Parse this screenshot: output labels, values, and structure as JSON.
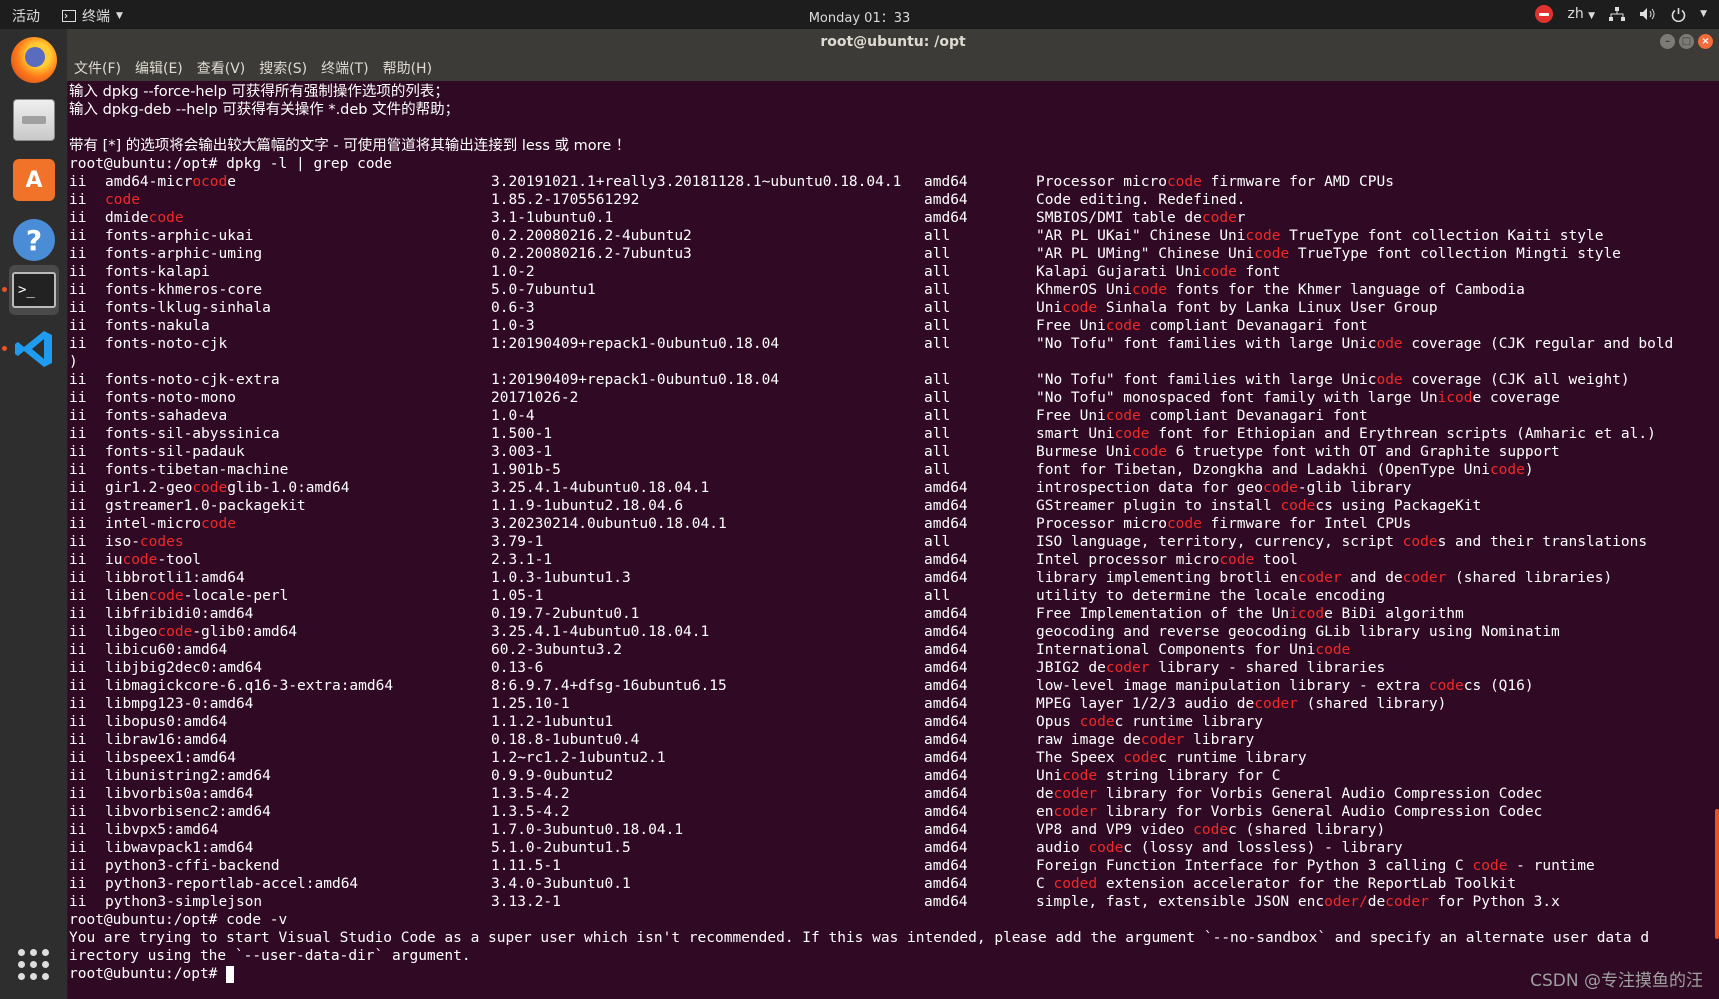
{
  "topbar": {
    "activities": "活动",
    "app_name": "终端",
    "clock": "Monday 01：33",
    "lang": "zh"
  },
  "window": {
    "title": "root@ubuntu: /opt",
    "menus": [
      "文件(F)",
      "编辑(E)",
      "查看(V)",
      "搜索(S)",
      "终端(T)",
      "帮助(H)"
    ]
  },
  "terminal": {
    "intro": [
      "输入 dpkg --force-help 可获得所有强制操作选项的列表；",
      "输入 dpkg-deb --help 可获得有关操作 *.deb 文件的帮助；",
      "",
      "带有 [*] 的选项将会输出较大篇幅的文字 - 可使用管道将其输出连接到 less 或 more ！"
    ],
    "prompt": "root@ubuntu:/opt# ",
    "cmd1": "dpkg -l | grep code",
    "highlight_term": "code",
    "rows": [
      {
        "s": "ii",
        "n": "amd64-microcode",
        "v": "3.20191021.1+really3.20181128.1~ubuntu0.18.04.1",
        "a": "amd64",
        "d": "Processor microcode firmware for AMD CPUs",
        "nh": [
          [
            10,
            14
          ]
        ],
        "dh": [
          [
            15,
            19
          ]
        ]
      },
      {
        "s": "ii",
        "n": "code",
        "v": "1.85.2-1705561292",
        "a": "amd64",
        "d": "Code editing. Redefined.",
        "nh": [
          [
            0,
            4
          ]
        ],
        "dh": []
      },
      {
        "s": "ii",
        "n": "dmidecode",
        "v": "3.1-1ubuntu0.1",
        "a": "amd64",
        "d": "SMBIOS/DMI table decoder",
        "nh": [
          [
            5,
            9
          ]
        ],
        "dh": [
          [
            19,
            23
          ]
        ]
      },
      {
        "s": "ii",
        "n": "fonts-arphic-ukai",
        "v": "0.2.20080216.2-4ubuntu2",
        "a": "all",
        "d": "\"AR PL UKai\" Chinese Unicode TrueType font collection Kaiti style",
        "nh": [],
        "dh": [
          [
            24,
            28
          ]
        ]
      },
      {
        "s": "ii",
        "n": "fonts-arphic-uming",
        "v": "0.2.20080216.2-7ubuntu3",
        "a": "all",
        "d": "\"AR PL UMing\" Chinese Unicode TrueType font collection Mingti style",
        "nh": [],
        "dh": [
          [
            25,
            29
          ]
        ]
      },
      {
        "s": "ii",
        "n": "fonts-kalapi",
        "v": "1.0-2",
        "a": "all",
        "d": "Kalapi Gujarati Unicode font",
        "nh": [],
        "dh": [
          [
            19,
            23
          ]
        ]
      },
      {
        "s": "ii",
        "n": "fonts-khmeros-core",
        "v": "5.0-7ubuntu1",
        "a": "all",
        "d": "KhmerOS Unicode fonts for the Khmer language of Cambodia",
        "nh": [],
        "dh": [
          [
            11,
            15
          ]
        ]
      },
      {
        "s": "ii",
        "n": "fonts-lklug-sinhala",
        "v": "0.6-3",
        "a": "all",
        "d": "Unicode Sinhala font by Lanka Linux User Group",
        "nh": [],
        "dh": [
          [
            3,
            7
          ]
        ]
      },
      {
        "s": "ii",
        "n": "fonts-nakula",
        "v": "1.0-3",
        "a": "all",
        "d": "Free Unicode compliant Devanagari font",
        "nh": [],
        "dh": [
          [
            8,
            12
          ]
        ]
      },
      {
        "s": "ii",
        "n": "fonts-noto-cjk",
        "v": "1:20190409+repack1-0ubuntu0.18.04",
        "a": "all",
        "d": "\"No Tofu\" font families with large Unicode coverage (CJK regular and bold",
        "nh": [],
        "dh": [
          [
            39,
            43
          ]
        ],
        "wrap": ")"
      },
      {
        "s": "ii",
        "n": "fonts-noto-cjk-extra",
        "v": "1:20190409+repack1-0ubuntu0.18.04",
        "a": "all",
        "d": "\"No Tofu\" font families with large Unicode coverage (CJK all weight)",
        "nh": [],
        "dh": [
          [
            39,
            43
          ]
        ]
      },
      {
        "s": "ii",
        "n": "fonts-noto-mono",
        "v": "20171026-2",
        "a": "all",
        "d": "\"No Tofu\" monospaced font family with large Unicode coverage",
        "nh": [],
        "dh": [
          [
            46,
            50
          ]
        ]
      },
      {
        "s": "ii",
        "n": "fonts-sahadeva",
        "v": "1.0-4",
        "a": "all",
        "d": "Free Unicode compliant Devanagari font",
        "nh": [],
        "dh": [
          [
            8,
            12
          ]
        ]
      },
      {
        "s": "ii",
        "n": "fonts-sil-abyssinica",
        "v": "1.500-1",
        "a": "all",
        "d": "smart Unicode font for Ethiopian and Erythrean scripts (Amharic et al.)",
        "nh": [],
        "dh": [
          [
            9,
            13
          ]
        ]
      },
      {
        "s": "ii",
        "n": "fonts-sil-padauk",
        "v": "3.003-1",
        "a": "all",
        "d": "Burmese Unicode 6 truetype font with OT and Graphite support",
        "nh": [],
        "dh": [
          [
            11,
            15
          ]
        ]
      },
      {
        "s": "ii",
        "n": "fonts-tibetan-machine",
        "v": "1.901b-5",
        "a": "all",
        "d": "font for Tibetan, Dzongkha and Ladakhi (OpenType Unicode)",
        "nh": [],
        "dh": [
          [
            52,
            56
          ]
        ]
      },
      {
        "s": "ii",
        "n": "gir1.2-geocodeglib-1.0:amd64",
        "v": "3.25.4.1-4ubuntu0.18.04.1",
        "a": "amd64",
        "d": "introspection data for geocode-glib library",
        "nh": [
          [
            10,
            14
          ]
        ],
        "dh": [
          [
            26,
            30
          ]
        ]
      },
      {
        "s": "ii",
        "n": "gstreamer1.0-packagekit",
        "v": "1.1.9-1ubuntu2.18.04.6",
        "a": "amd64",
        "d": "GStreamer plugin to install codecs using PackageKit",
        "nh": [],
        "dh": [
          [
            28,
            32
          ]
        ]
      },
      {
        "s": "ii",
        "n": "intel-microcode",
        "v": "3.20230214.0ubuntu0.18.04.1",
        "a": "amd64",
        "d": "Processor microcode firmware for Intel CPUs",
        "nh": [
          [
            11,
            15
          ]
        ],
        "dh": [
          [
            15,
            19
          ]
        ]
      },
      {
        "s": "ii",
        "n": "iso-codes",
        "v": "3.79-1",
        "a": "all",
        "d": "ISO language, territory, currency, script codes and their translations",
        "nh": [
          [
            4,
            9
          ]
        ],
        "dh": [
          [
            41,
            46
          ]
        ]
      },
      {
        "s": "ii",
        "n": "iucode-tool",
        "v": "2.3.1-1",
        "a": "amd64",
        "d": "Intel processor microcode tool",
        "nh": [
          [
            2,
            6
          ]
        ],
        "dh": [
          [
            21,
            25
          ]
        ]
      },
      {
        "s": "ii",
        "n": "libbrotli1:amd64",
        "v": "1.0.3-1ubuntu1.3",
        "a": "amd64",
        "d": "library implementing brotli encoder and decoder (shared libraries)",
        "nh": [],
        "dh": [
          [
            30,
            35
          ],
          [
            42,
            47
          ]
        ]
      },
      {
        "s": "ii",
        "n": "libencode-locale-perl",
        "v": "1.05-1",
        "a": "all",
        "d": "utility to determine the locale encoding",
        "nh": [
          [
            5,
            9
          ]
        ],
        "dh": []
      },
      {
        "s": "ii",
        "n": "libfribidi0:amd64",
        "v": "0.19.7-2ubuntu0.1",
        "a": "amd64",
        "d": "Free Implementation of the Unicode BiDi algorithm",
        "nh": [],
        "dh": [
          [
            29,
            33
          ]
        ]
      },
      {
        "s": "ii",
        "n": "libgeocode-glib0:amd64",
        "v": "3.25.4.1-4ubuntu0.18.04.1",
        "a": "amd64",
        "d": "geocoding and reverse geocoding GLib library using Nominatim",
        "nh": [
          [
            6,
            10
          ]
        ],
        "dh": []
      },
      {
        "s": "ii",
        "n": "libicu60:amd64",
        "v": "60.2-3ubuntu3.2",
        "a": "amd64",
        "d": "International Components for Unicode",
        "nh": [],
        "dh": [
          [
            32,
            36
          ]
        ]
      },
      {
        "s": "ii",
        "n": "libjbig2dec0:amd64",
        "v": "0.13-6",
        "a": "amd64",
        "d": "JBIG2 decoder library - shared libraries",
        "nh": [],
        "dh": [
          [
            8,
            13
          ]
        ]
      },
      {
        "s": "ii",
        "n": "libmagickcore-6.q16-3-extra:amd64",
        "v": "8:6.9.7.4+dfsg-16ubuntu6.15",
        "a": "amd64",
        "d": "low-level image manipulation library - extra codecs (Q16)",
        "nh": [],
        "dh": [
          [
            45,
            49
          ]
        ]
      },
      {
        "s": "ii",
        "n": "libmpg123-0:amd64",
        "v": "1.25.10-1",
        "a": "amd64",
        "d": "MPEG layer 1/2/3 audio decoder (shared library)",
        "nh": [],
        "dh": [
          [
            25,
            30
          ]
        ]
      },
      {
        "s": "ii",
        "n": "libopus0:amd64",
        "v": "1.1.2-1ubuntu1",
        "a": "amd64",
        "d": "Opus codec runtime library",
        "nh": [],
        "dh": [
          [
            5,
            9
          ]
        ]
      },
      {
        "s": "ii",
        "n": "libraw16:amd64",
        "v": "0.18.8-1ubuntu0.4",
        "a": "amd64",
        "d": "raw image decoder library",
        "nh": [],
        "dh": [
          [
            12,
            17
          ]
        ]
      },
      {
        "s": "ii",
        "n": "libspeex1:amd64",
        "v": "1.2~rc1.2-1ubuntu2.1",
        "a": "amd64",
        "d": "The Speex codec runtime library",
        "nh": [],
        "dh": [
          [
            10,
            14
          ]
        ]
      },
      {
        "s": "ii",
        "n": "libunistring2:amd64",
        "v": "0.9.9-0ubuntu2",
        "a": "amd64",
        "d": "Unicode string library for C",
        "nh": [],
        "dh": [
          [
            3,
            7
          ]
        ]
      },
      {
        "s": "ii",
        "n": "libvorbis0a:amd64",
        "v": "1.3.5-4.2",
        "a": "amd64",
        "d": "decoder library for Vorbis General Audio Compression Codec",
        "nh": [],
        "dh": [
          [
            2,
            7
          ]
        ]
      },
      {
        "s": "ii",
        "n": "libvorbisenc2:amd64",
        "v": "1.3.5-4.2",
        "a": "amd64",
        "d": "encoder library for Vorbis General Audio Compression Codec",
        "nh": [],
        "dh": [
          [
            2,
            7
          ]
        ]
      },
      {
        "s": "ii",
        "n": "libvpx5:amd64",
        "v": "1.7.0-3ubuntu0.18.04.1",
        "a": "amd64",
        "d": "VP8 and VP9 video codec (shared library)",
        "nh": [],
        "dh": [
          [
            18,
            22
          ]
        ]
      },
      {
        "s": "ii",
        "n": "libwavpack1:amd64",
        "v": "5.1.0-2ubuntu1.5",
        "a": "amd64",
        "d": "audio codec (lossy and lossless) - library",
        "nh": [],
        "dh": [
          [
            6,
            10
          ]
        ]
      },
      {
        "s": "ii",
        "n": "python3-cffi-backend",
        "v": "1.11.5-1",
        "a": "amd64",
        "d": "Foreign Function Interface for Python 3 calling C code - runtime",
        "nh": [],
        "dh": [
          [
            50,
            54
          ]
        ]
      },
      {
        "s": "ii",
        "n": "python3-reportlab-accel:amd64",
        "v": "3.4.0-3ubuntu0.1",
        "a": "amd64",
        "d": "C coded extension accelerator for the ReportLab Toolkit",
        "nh": [],
        "dh": [
          [
            2,
            7
          ]
        ]
      },
      {
        "s": "ii",
        "n": "python3-simplejson",
        "v": "3.13.2-1",
        "a": "amd64",
        "d": "simple, fast, extensible JSON encoder/decoder for Python 3.x",
        "nh": [],
        "dh": [
          [
            33,
            38
          ],
          [
            40,
            45
          ]
        ]
      }
    ],
    "cmd2": "code -v",
    "message1": "You are trying to start Visual Studio Code as a super user which isn't recommended. If this was intended, please add the argument `--no-sandbox` and specify an alternate user data d",
    "message2": "irectory using the `--user-data-dir` argument."
  },
  "dock": {
    "icons": [
      "firefox-icon",
      "files-icon",
      "software-center-icon",
      "help-icon",
      "terminal-icon",
      "vscode-icon"
    ]
  },
  "colors": {
    "terminal_bg": "#300a24",
    "highlight": "#ef2929",
    "accent": "#e95420"
  },
  "watermark": "CSDN @专注摸鱼的汪"
}
